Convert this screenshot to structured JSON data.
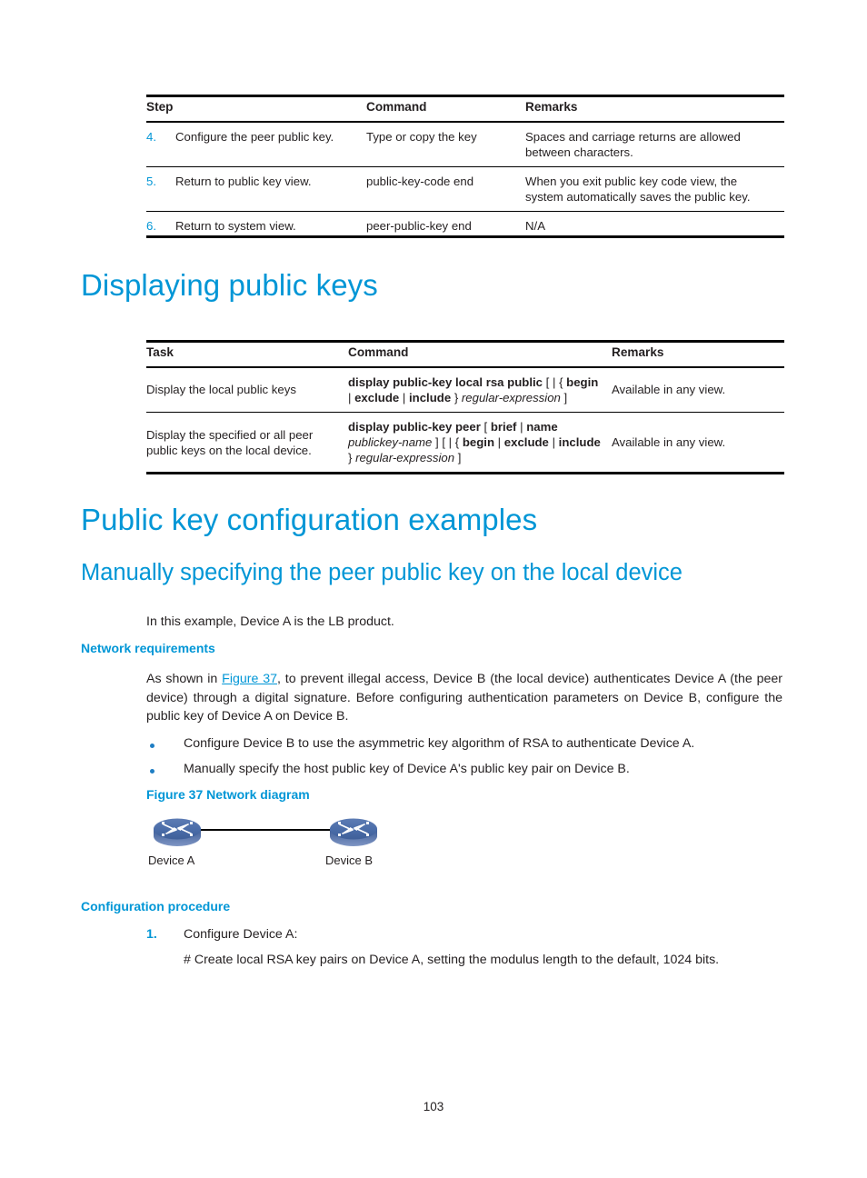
{
  "table_steps": {
    "headers": [
      "Step",
      "Command",
      "Remarks"
    ],
    "rows": [
      {
        "num": "4.",
        "step": "Configure the peer public key.",
        "command_plain": "Type or copy the key",
        "remarks": "Spaces and carriage returns are allowed between characters."
      },
      {
        "num": "5.",
        "step": "Return to public key view.",
        "command_bold": "public-key-code end",
        "remarks": "When you exit public key code view, the system automatically saves the public key."
      },
      {
        "num": "6.",
        "step": "Return to system view.",
        "command_bold": "peer-public-key end",
        "remarks": "N/A"
      }
    ]
  },
  "heading_displaying": "Displaying public keys",
  "table_display": {
    "headers": [
      "Task",
      "Command",
      "Remarks"
    ],
    "rows": [
      {
        "task": "Display the local public keys",
        "cmd_parts": [
          {
            "text": "display public-key local rsa public",
            "style": "bold"
          },
          {
            "text": " [ | { ",
            "style": "plain"
          },
          {
            "text": "begin",
            "style": "bold"
          },
          {
            "text": " | ",
            "style": "plain"
          },
          {
            "text": "exclude",
            "style": "bold"
          },
          {
            "text": " | ",
            "style": "plain"
          },
          {
            "text": "include",
            "style": "bold"
          },
          {
            "text": " } ",
            "style": "plain"
          },
          {
            "text": "regular-expression",
            "style": "italic"
          },
          {
            "text": " ]",
            "style": "plain"
          }
        ],
        "remarks": "Available in any view."
      },
      {
        "task": "Display the specified or all peer public keys on the local device.",
        "cmd_parts": [
          {
            "text": "display public-key peer",
            "style": "bold"
          },
          {
            "text": " [ ",
            "style": "plain"
          },
          {
            "text": "brief",
            "style": "bold"
          },
          {
            "text": " | ",
            "style": "plain"
          },
          {
            "text": "name",
            "style": "bold"
          },
          {
            "text": " ",
            "style": "plain"
          },
          {
            "text": "publickey-name",
            "style": "italic"
          },
          {
            "text": " ] [ | { ",
            "style": "plain"
          },
          {
            "text": "begin",
            "style": "bold"
          },
          {
            "text": " | ",
            "style": "plain"
          },
          {
            "text": "exclude",
            "style": "bold"
          },
          {
            "text": " | ",
            "style": "plain"
          },
          {
            "text": "include",
            "style": "bold"
          },
          {
            "text": " } ",
            "style": "plain"
          },
          {
            "text": "regular-expression",
            "style": "italic"
          },
          {
            "text": " ]",
            "style": "plain"
          }
        ],
        "remarks": "Available in any view."
      }
    ]
  },
  "heading_examples": "Public key configuration examples",
  "heading_manually": "Manually specifying the peer public key on the local device",
  "intro_paragraph": "In this example, Device A is the LB product.",
  "heading_network_req": "Network requirements",
  "network_req": {
    "text_before_link": "As shown in ",
    "link_text": "Figure 37",
    "text_after_link": ", to prevent illegal access, Device B (the local device) authenticates Device A (the peer device) through a digital signature. Before configuring authentication parameters on Device B, configure the public key of Device A on Device B.",
    "bullets": [
      "Configure Device B to use the asymmetric key algorithm of RSA to authenticate Device A.",
      "Manually specify the host public key of Device A's public key pair on Device B."
    ]
  },
  "figure": {
    "caption": "Figure 37 Network diagram",
    "device_a_label": "Device A",
    "device_b_label": "Device B",
    "icon_name": "switch-icon"
  },
  "heading_config_proc": "Configuration procedure",
  "config_steps": [
    {
      "marker": "1.",
      "text": "Configure Device A:"
    }
  ],
  "config_comment": "# Create local RSA key pairs on Device A, setting the modulus length to the default, 1024 bits.",
  "page_number": "103",
  "colors": {
    "heading_blue": "#0096d6",
    "text_black": "#231f20",
    "bullet_blue": "#1f7ec4"
  }
}
